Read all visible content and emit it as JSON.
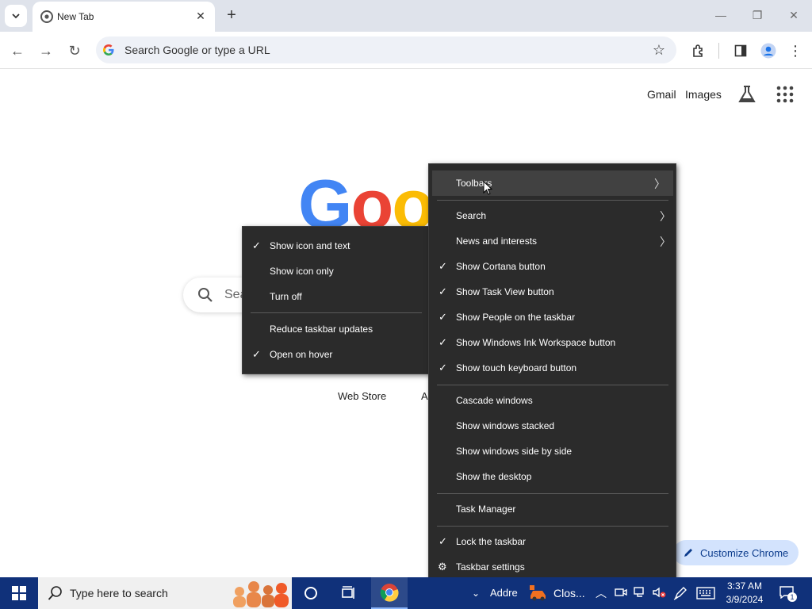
{
  "browser": {
    "tab_title": "New Tab",
    "omnibox_placeholder": "Search Google or type a URL"
  },
  "page": {
    "top_links": [
      "Gmail",
      "Images"
    ],
    "logo_text": "Goo",
    "search_placeholder": "Sea",
    "shortcuts": [
      "Web Store",
      "A"
    ],
    "customize_label": "Customize Chrome"
  },
  "taskbar_menu": {
    "items": [
      {
        "label": "Toolbars",
        "checked": false,
        "submenu": true,
        "highlighted": true
      },
      {
        "label": "Search",
        "checked": false,
        "submenu": true
      },
      {
        "label": "News and interests",
        "checked": false,
        "submenu": true
      },
      {
        "label": "Show Cortana button",
        "checked": true
      },
      {
        "label": "Show Task View button",
        "checked": true
      },
      {
        "label": "Show People on the taskbar",
        "checked": true
      },
      {
        "label": "Show Windows Ink Workspace button",
        "checked": true
      },
      {
        "label": "Show touch keyboard button",
        "checked": true
      },
      {
        "label": "Cascade windows",
        "checked": false
      },
      {
        "label": "Show windows stacked",
        "checked": false
      },
      {
        "label": "Show windows side by side",
        "checked": false
      },
      {
        "label": "Show the desktop",
        "checked": false
      },
      {
        "label": "Task Manager",
        "checked": false
      },
      {
        "label": "Lock the taskbar",
        "checked": true
      },
      {
        "label": "Taskbar settings",
        "checked": false,
        "gear": true
      }
    ]
  },
  "news_submenu": {
    "items": [
      {
        "label": "Show icon and text",
        "checked": true
      },
      {
        "label": "Show icon only",
        "checked": false
      },
      {
        "label": "Turn off",
        "checked": false
      },
      {
        "label": "Reduce taskbar updates",
        "checked": false
      },
      {
        "label": "Open on hover",
        "checked": true
      }
    ]
  },
  "taskbar": {
    "search_placeholder": "Type here to search",
    "address_label": "Addre",
    "app_label": "Clos...",
    "time": "3:37 AM",
    "date": "3/9/2024",
    "notification_count": "1"
  },
  "colors": {
    "taskbar": "#10317a",
    "menu_bg": "#2b2b2b",
    "customize_bg": "#d3e3fd"
  }
}
